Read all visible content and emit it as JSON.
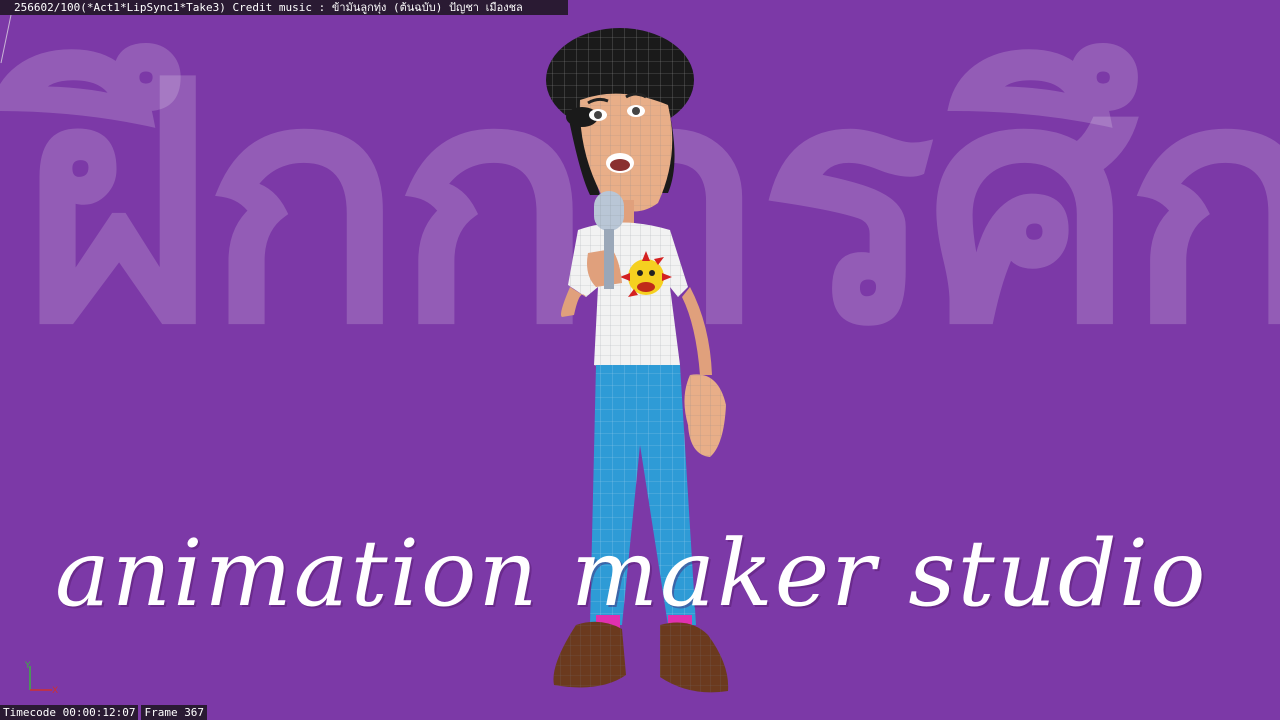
{
  "viewport": {
    "title_bar": "256602/100(*Act1*LipSync1*Take3)  Credit music : ข้ามันลูกทุ่ง (ต้นฉบับ) ปัญชา เมืองชล",
    "background_text": "ฝึกการศึกษา",
    "overlay_text": "animation maker studio",
    "timecode": "Timecode 00:00:12:07",
    "frame": "Frame 367",
    "axis_labels": {
      "y": "Y",
      "x": "X"
    },
    "colors": {
      "background": "#7c39a7",
      "bar": "#2a1a33",
      "text": "#ffffff"
    }
  }
}
